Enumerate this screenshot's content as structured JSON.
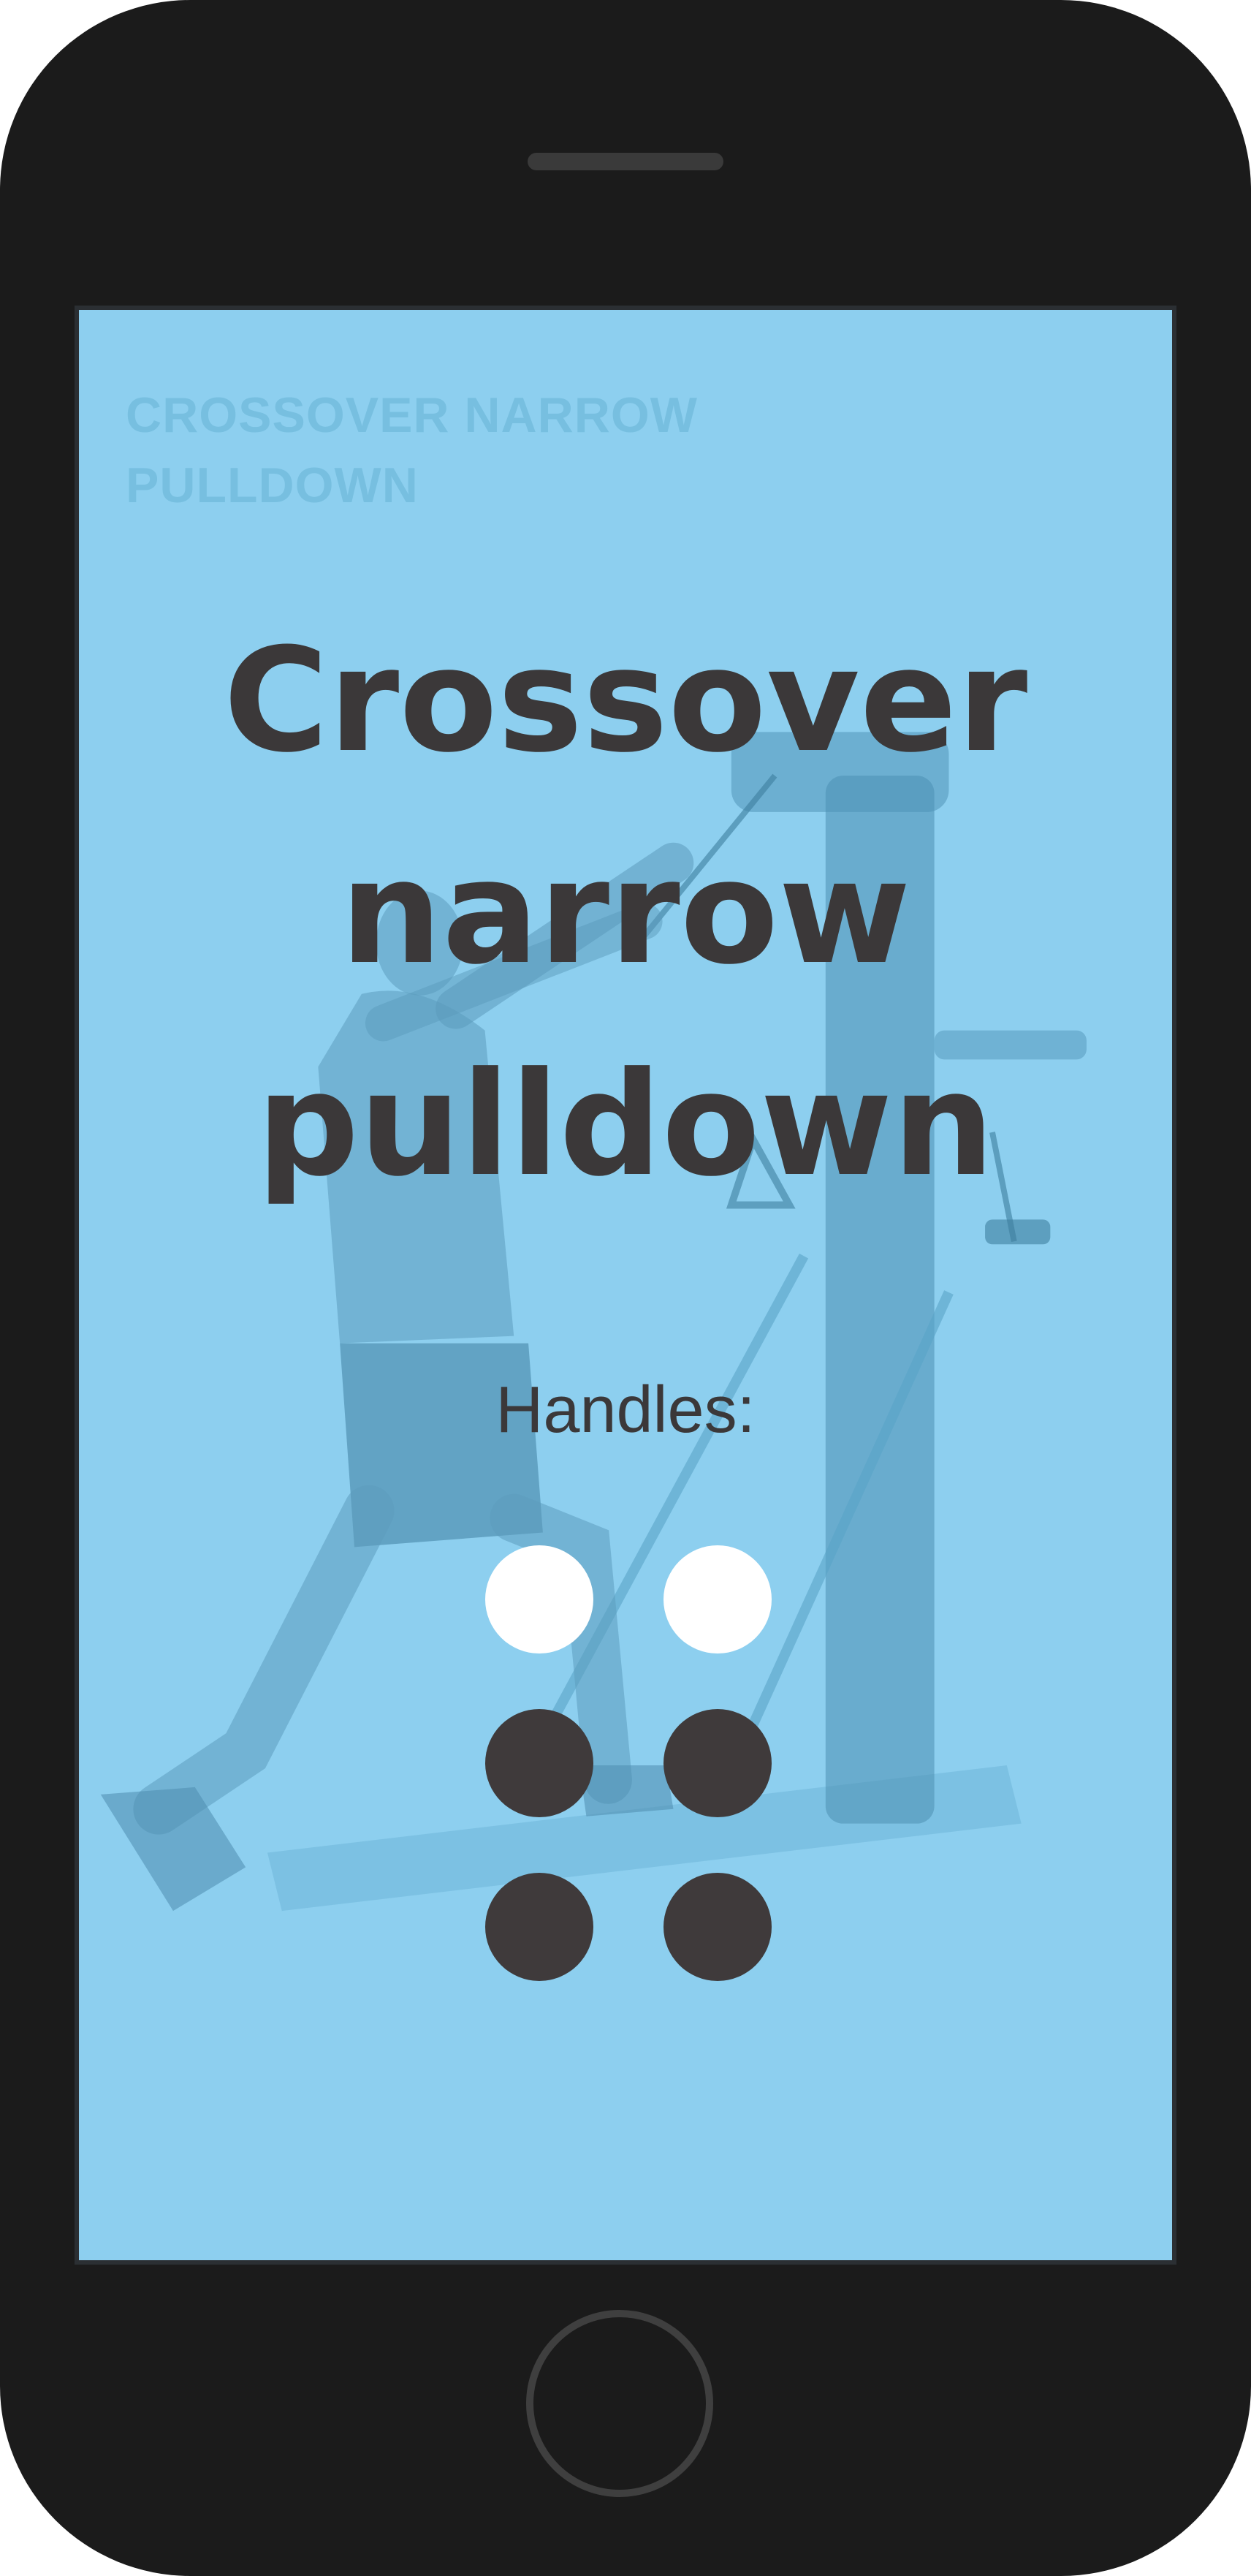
{
  "screen": {
    "background_color": "#8dcfef",
    "exercise_label": "CROSSOVER NARROW PULLDOWN",
    "title": "Crossover narrow pulldown",
    "handles_label": "Handles:",
    "handles": [
      {
        "position": "top-left",
        "active": true
      },
      {
        "position": "top-right",
        "active": true
      },
      {
        "position": "middle-left",
        "active": false
      },
      {
        "position": "middle-right",
        "active": false
      },
      {
        "position": "bottom-left",
        "active": false
      },
      {
        "position": "bottom-right",
        "active": false
      }
    ],
    "colors": {
      "active_handle": "#ffffff",
      "inactive_handle": "#3f3a3b",
      "text": "#3b3839"
    }
  }
}
